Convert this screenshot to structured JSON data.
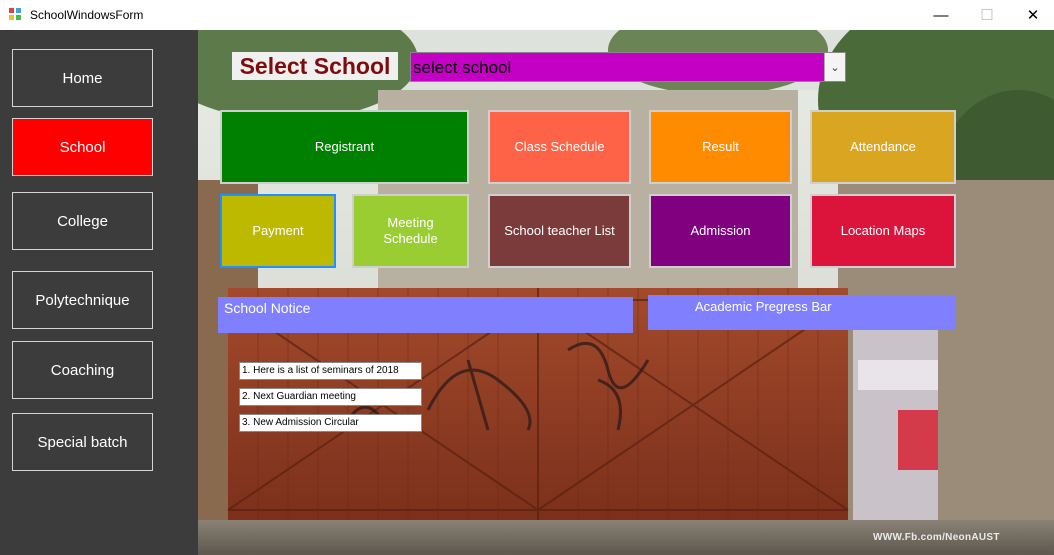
{
  "window": {
    "title": "SchoolWindowsForm",
    "min_glyph": "—",
    "max_glyph": "☐",
    "close_glyph": "✕"
  },
  "sidebar": {
    "items": [
      {
        "label": "Home",
        "active": false
      },
      {
        "label": "School",
        "active": true
      },
      {
        "label": "College",
        "active": false
      },
      {
        "label": "Polytechnique",
        "active": false
      },
      {
        "label": "Coaching",
        "active": false
      },
      {
        "label": "Special batch",
        "active": false
      }
    ]
  },
  "main": {
    "select_label": "Select School",
    "combo": {
      "value": "select school",
      "arrow": "⌄"
    },
    "tiles": {
      "registrant": "Registrant",
      "class_schedule": "Class Schedule",
      "result": "Result",
      "attendance": "Attendance",
      "payment": "Payment",
      "meeting_schedule": "Meeting Schedule",
      "teacher_list": "School teacher List",
      "admission": "Admission",
      "location_maps": "Location Maps"
    },
    "notice_title": "School Notice",
    "progress_title": "Academic Pregress Bar",
    "notices": [
      "1. Here is a list of seminars of 2018",
      "2. Next Guardian meeting",
      "3. New Admission Circular"
    ],
    "watermark": "WWW.Fb.com/NeonAUST"
  },
  "colors": {
    "sidebar_bg": "#3c3c3c",
    "active": "#ff0000",
    "combo_bg": "#c300c3",
    "registrant": "#008000",
    "class_schedule": "#ff6347",
    "result": "#ff8c00",
    "attendance": "#daa520",
    "payment": "#bdb800",
    "meeting_schedule": "#9acd32",
    "teacher_list": "#7b3b3b",
    "admission": "#800080",
    "location_maps": "#dc143c",
    "notice_header": "#8080ff",
    "label_text": "#7d0d0d"
  }
}
